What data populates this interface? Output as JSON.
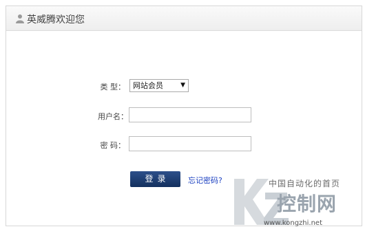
{
  "header": {
    "title": "英威腾欢迎您"
  },
  "form": {
    "type_label": "类  型：",
    "type_value": "网站会员",
    "username_label": "用户名：",
    "username_value": "",
    "password_label": "密  码：",
    "password_value": "",
    "login_button": "登录",
    "forgot_link": "忘记密码?"
  },
  "watermark": {
    "line1": "中国自动化的首页",
    "line2": "控制网",
    "url": "www.kongzhi.net"
  },
  "colors": {
    "button": "#1f3f75",
    "link": "#1a3fc0"
  }
}
